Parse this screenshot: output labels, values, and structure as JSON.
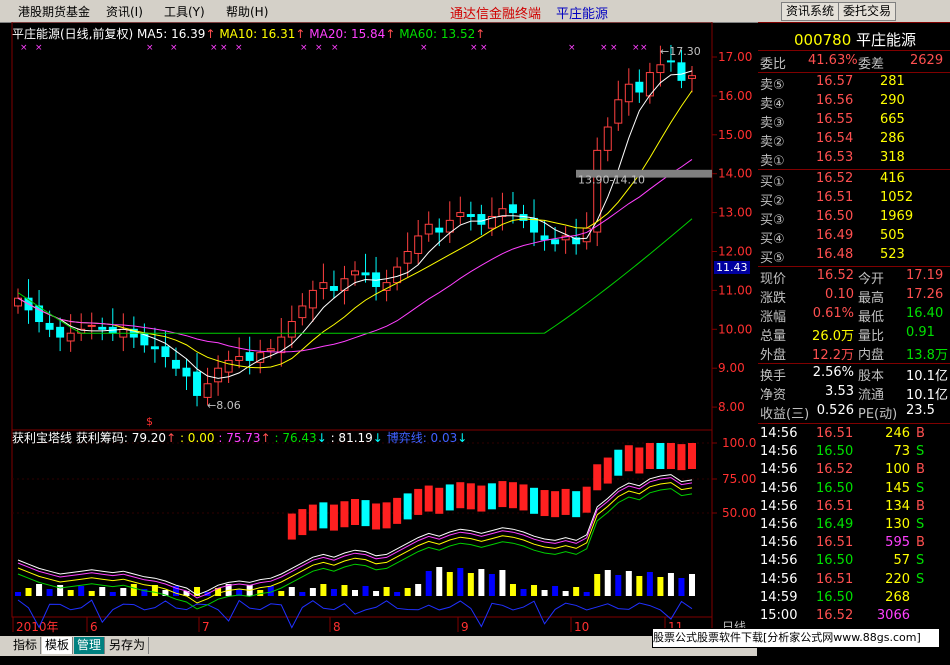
{
  "menu": {
    "items": [
      "港股期货基金",
      "资讯(I)",
      "工具(Y)",
      "帮助(H)"
    ],
    "app_title": "通达信金融终端",
    "app_subtitle": "平庄能源",
    "btn_info": "资讯系统",
    "btn_trade": "委托交易"
  },
  "main_chart": {
    "legend_name": "平庄能源(日线,前复权)",
    "ma5": "MA5: 16.39",
    "ma10": "MA10: 16.31",
    "ma20": "MA20: 15.84",
    "ma60": "MA60: 13.52",
    "y_ticks": [
      "17.00",
      "16.00",
      "15.00",
      "14.00",
      "13.00",
      "12.00",
      "11.00",
      "10.00",
      "9.00",
      "8.00"
    ],
    "price_badge": "11.43",
    "high_label": "17.30",
    "low_label": "8.06",
    "gap_label": "13.90-14.10",
    "marker": "$"
  },
  "sub_chart": {
    "title": "获利宝塔线",
    "val1": "获利筹码: 79.20",
    "val2": ": 0.00",
    "val3": ": 75.73",
    "val4": ": 76.43",
    "val5": ": 81.19",
    "val6": "博弈线: 0.03",
    "y_ticks": [
      "100.0",
      "75.00",
      "50.00"
    ]
  },
  "x_axis": [
    "2010年",
    "6",
    "7",
    "8",
    "9",
    "10",
    "11"
  ],
  "x_right": "日线",
  "chart_data": {
    "type": "candlestick",
    "x_month_labels": [
      "6",
      "7",
      "8",
      "9",
      "10",
      "11"
    ],
    "ylim": [
      7.8,
      17.5
    ],
    "ma_last": {
      "MA5": 16.39,
      "MA10": 16.31,
      "MA20": 15.84,
      "MA60": 13.52
    },
    "close": [
      10.8,
      10.5,
      10.2,
      10.0,
      9.8,
      9.9,
      10.0,
      10.1,
      10.0,
      9.9,
      10.0,
      9.8,
      9.6,
      9.5,
      9.3,
      9.0,
      8.8,
      8.3,
      8.6,
      9.0,
      9.2,
      9.3,
      9.2,
      9.4,
      9.5,
      9.8,
      10.2,
      10.6,
      11.0,
      11.2,
      11.0,
      11.3,
      11.5,
      11.4,
      11.1,
      11.2,
      11.6,
      12.0,
      12.4,
      12.7,
      12.5,
      12.8,
      13.0,
      12.9,
      12.7,
      12.9,
      13.1,
      13.0,
      12.8,
      12.5,
      12.3,
      12.2,
      12.4,
      12.2,
      12.6,
      14.6,
      15.2,
      15.9,
      16.3,
      16.1,
      16.6,
      16.8,
      16.9,
      16.4,
      16.52
    ]
  },
  "quote": {
    "code": "000780",
    "name": "平庄能源",
    "weibi_label": "委比",
    "weibi": "41.63%",
    "weicha_label": "委差",
    "weicha": "2629",
    "asks": [
      {
        "label": "卖⑤",
        "price": "16.57",
        "vol": "281"
      },
      {
        "label": "卖④",
        "price": "16.56",
        "vol": "290"
      },
      {
        "label": "卖③",
        "price": "16.55",
        "vol": "665"
      },
      {
        "label": "卖②",
        "price": "16.54",
        "vol": "286"
      },
      {
        "label": "卖①",
        "price": "16.53",
        "vol": "318"
      }
    ],
    "bids": [
      {
        "label": "买①",
        "price": "16.52",
        "vol": "416"
      },
      {
        "label": "买②",
        "price": "16.51",
        "vol": "1052"
      },
      {
        "label": "买③",
        "price": "16.50",
        "vol": "1969"
      },
      {
        "label": "买④",
        "price": "16.49",
        "vol": "505"
      },
      {
        "label": "买⑤",
        "price": "16.48",
        "vol": "523"
      }
    ],
    "stats": [
      {
        "l1": "现价",
        "v1": "16.52",
        "c1": "r",
        "l2": "今开",
        "v2": "17.19",
        "c2": "r"
      },
      {
        "l1": "涨跌",
        "v1": "0.10",
        "c1": "r",
        "l2": "最高",
        "v2": "17.26",
        "c2": "r"
      },
      {
        "l1": "涨幅",
        "v1": "0.61%",
        "c1": "r",
        "l2": "最低",
        "v2": "16.40",
        "c2": "g"
      },
      {
        "l1": "总量",
        "v1": "26.0万",
        "c1": "y",
        "l2": "量比",
        "v2": "0.91",
        "c2": "g"
      },
      {
        "l1": "外盘",
        "v1": "12.2万",
        "c1": "r",
        "l2": "内盘",
        "v2": "13.8万",
        "c2": "g"
      },
      {
        "l1": "换手",
        "v1": "2.56%",
        "c1": "w",
        "l2": "股本",
        "v2": "10.1亿",
        "c2": "w"
      },
      {
        "l1": "净资",
        "v1": "3.53",
        "c1": "w",
        "l2": "流通",
        "v2": "10.1亿",
        "c2": "w"
      },
      {
        "l1": "收益(三)",
        "v1": "0.526",
        "c1": "w",
        "l2": "PE(动)",
        "v2": "23.5",
        "c2": "w"
      }
    ],
    "ticks": [
      {
        "t": "14:56",
        "p": "16.51",
        "v": "246",
        "s": "B"
      },
      {
        "t": "14:56",
        "p": "16.50",
        "v": "73",
        "s": "S"
      },
      {
        "t": "14:56",
        "p": "16.52",
        "v": "100",
        "s": "B"
      },
      {
        "t": "14:56",
        "p": "16.50",
        "v": "145",
        "s": "S"
      },
      {
        "t": "14:56",
        "p": "16.51",
        "v": "134",
        "s": "B"
      },
      {
        "t": "14:56",
        "p": "16.49",
        "v": "130",
        "s": "S"
      },
      {
        "t": "14:56",
        "p": "16.51",
        "v": "595",
        "s": "B"
      },
      {
        "t": "14:56",
        "p": "16.50",
        "v": "57",
        "s": "S"
      },
      {
        "t": "14:56",
        "p": "16.51",
        "v": "220",
        "s": "S"
      },
      {
        "t": "14:59",
        "p": "16.50",
        "v": "268",
        "s": ""
      },
      {
        "t": "15:00",
        "p": "16.52",
        "v": "3066",
        "s": ""
      }
    ]
  },
  "tabs": [
    "指标",
    "模板",
    "管理",
    "另存为"
  ],
  "status_text": "股票公式股票软件下载[分析家公式网www.88gs.com]"
}
